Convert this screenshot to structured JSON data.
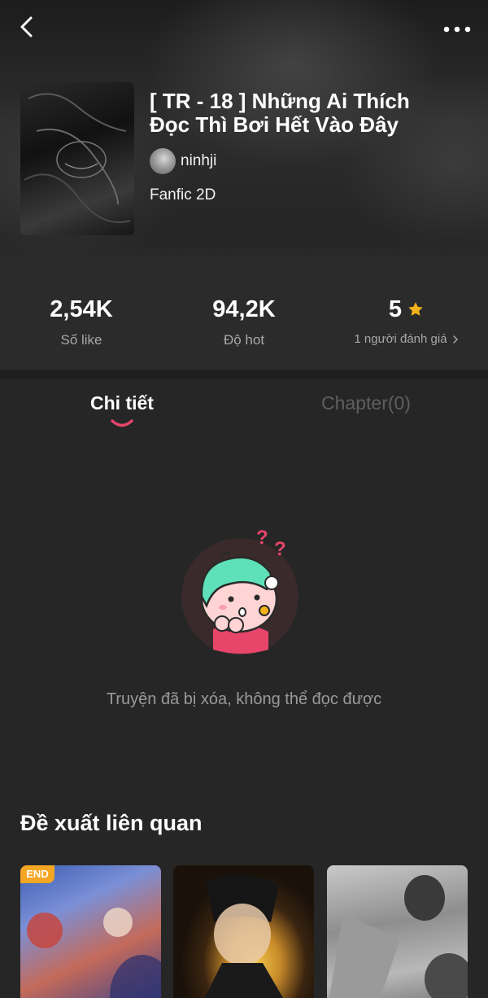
{
  "story": {
    "title": "[ TR - 18 ] Những Ai Thích Đọc Thì Bơi Hết Vào Đây",
    "author": "ninhji",
    "genre": "Fanfic 2D"
  },
  "stats": [
    {
      "value": "2,54K",
      "label": "Số like"
    },
    {
      "value": "94,2K",
      "label": "Độ hot"
    },
    {
      "value": "5",
      "label": "1 người đánh giá"
    }
  ],
  "tabs": [
    {
      "label": "Chi tiết",
      "active": true
    },
    {
      "label": "Chapter(0)",
      "active": false
    }
  ],
  "empty_state": {
    "message": "Truyện đã bị xóa, không thể đọc được"
  },
  "related": {
    "title": "Đề xuất liên quan",
    "cards": [
      {
        "badge": "END"
      },
      {
        "badge": ""
      },
      {
        "badge": ""
      }
    ]
  },
  "icons": {
    "back": "chevron-left-icon",
    "more": "more-horizontal-icon",
    "rating": "star-icon",
    "arrow": "chevron-right-icon"
  },
  "colors": {
    "accent": "#e8456b",
    "star": "#f5b21b",
    "badge": "#f5a623",
    "background": "#262626"
  }
}
